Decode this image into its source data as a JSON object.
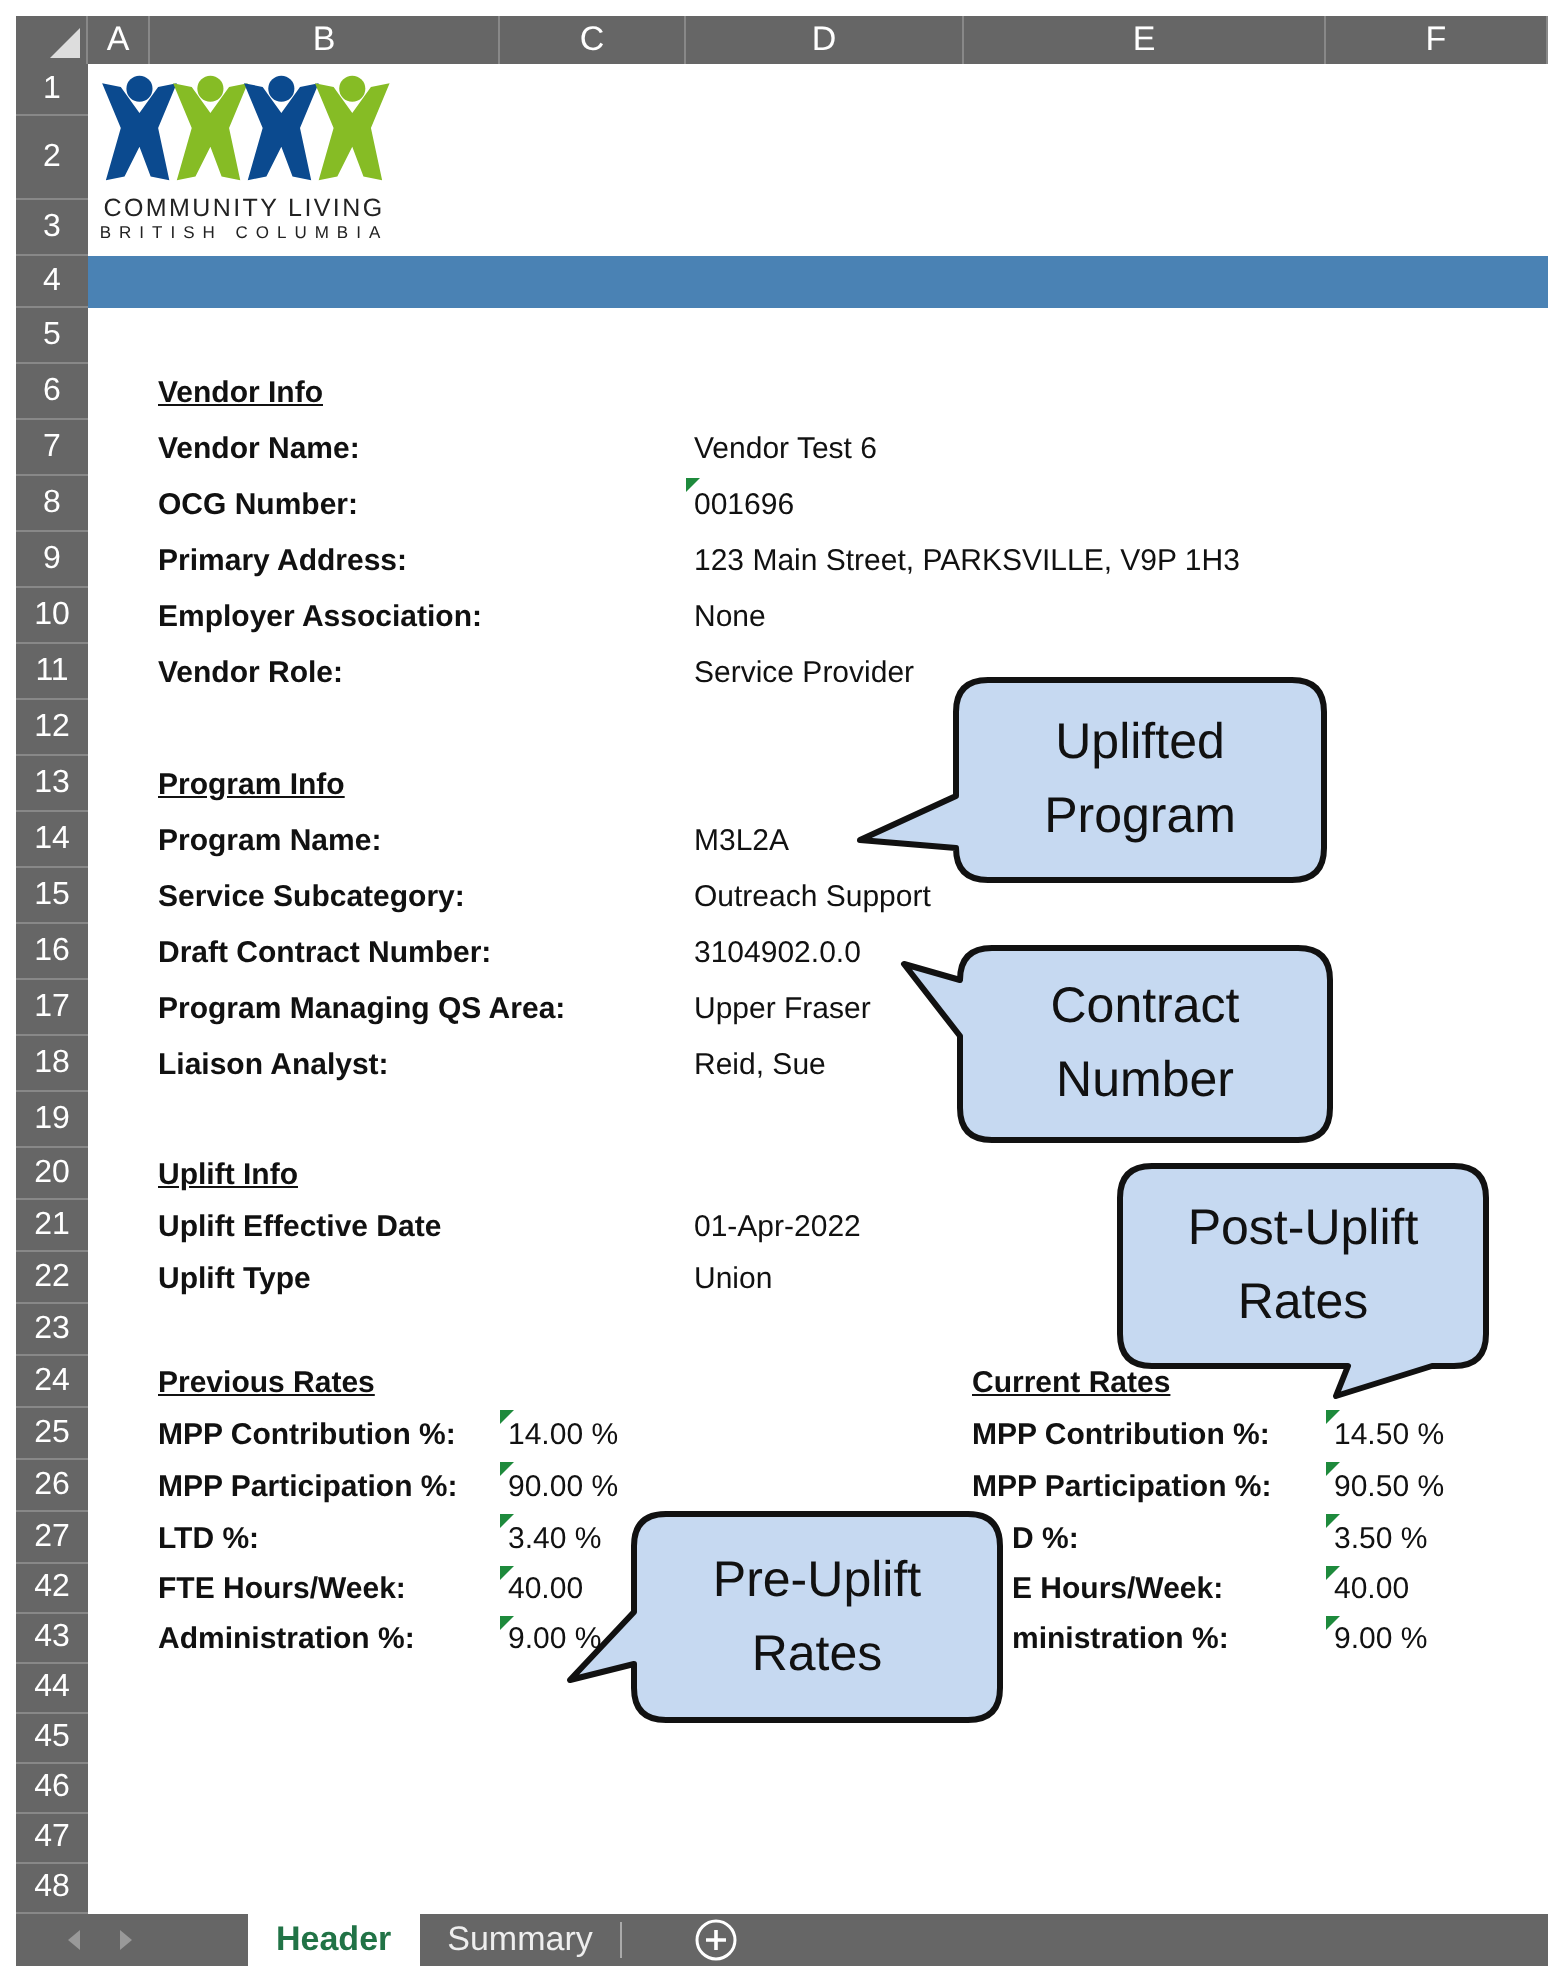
{
  "columns": [
    "A",
    "B",
    "C",
    "D",
    "E",
    "F"
  ],
  "logo": {
    "line1": "COMMUNITY LIVING",
    "line2": "BRITISH COLUMBIA"
  },
  "rows": [
    {
      "number": "1",
      "kind": "plain",
      "cells": {}
    },
    {
      "number": "2",
      "kind": "plain",
      "cells": {}
    },
    {
      "number": "3",
      "kind": "plain",
      "cells": {}
    },
    {
      "number": "4",
      "kind": "band",
      "cells": {}
    },
    {
      "number": "5",
      "kind": "plain",
      "cells": {}
    },
    {
      "number": "6",
      "kind": "plain",
      "cells": {
        "B": {
          "kind": "heading",
          "text": "Vendor Info",
          "flagged": false
        }
      }
    },
    {
      "number": "7",
      "kind": "plain",
      "cells": {
        "B": {
          "kind": "label",
          "text": "Vendor Name:",
          "flagged": false
        },
        "D": {
          "kind": "value",
          "text": "Vendor Test 6",
          "flagged": false
        }
      }
    },
    {
      "number": "8",
      "kind": "plain",
      "cells": {
        "B": {
          "kind": "label",
          "text": "OCG Number:",
          "flagged": false
        },
        "D": {
          "kind": "value",
          "text": "001696",
          "flagged": true
        }
      }
    },
    {
      "number": "9",
      "kind": "plain",
      "cells": {
        "B": {
          "kind": "label",
          "text": "Primary Address:",
          "flagged": false
        },
        "D": {
          "kind": "value",
          "text": " 123 Main Street, PARKSVILLE, V9P 1H3",
          "flagged": false
        }
      }
    },
    {
      "number": "10",
      "kind": "plain",
      "cells": {
        "B": {
          "kind": "label",
          "text": "Employer Association:",
          "flagged": false
        },
        "D": {
          "kind": "value",
          "text": "None",
          "flagged": false
        }
      }
    },
    {
      "number": "11",
      "kind": "plain",
      "cells": {
        "B": {
          "kind": "label",
          "text": "Vendor Role:",
          "flagged": false
        },
        "D": {
          "kind": "value",
          "text": "Service Provider",
          "flagged": false
        }
      }
    },
    {
      "number": "12",
      "kind": "plain",
      "cells": {}
    },
    {
      "number": "13",
      "kind": "plain",
      "cells": {
        "B": {
          "kind": "heading",
          "text": "Program Info",
          "flagged": false
        }
      }
    },
    {
      "number": "14",
      "kind": "plain",
      "cells": {
        "B": {
          "kind": "label",
          "text": "Program Name:",
          "flagged": false
        },
        "D": {
          "kind": "value",
          "text": "M3L2A",
          "flagged": false
        }
      }
    },
    {
      "number": "15",
      "kind": "plain",
      "cells": {
        "B": {
          "kind": "label",
          "text": "Service Subcategory:",
          "flagged": false
        },
        "D": {
          "kind": "value",
          "text": "Outreach Support",
          "flagged": false
        }
      }
    },
    {
      "number": "16",
      "kind": "plain",
      "cells": {
        "B": {
          "kind": "label",
          "text": "Draft Contract Number:",
          "flagged": false
        },
        "D": {
          "kind": "value",
          "text": "3104902.0.0",
          "flagged": false
        }
      }
    },
    {
      "number": "17",
      "kind": "plain",
      "cells": {
        "B": {
          "kind": "label",
          "text": "Program Managing QS Area:",
          "flagged": false
        },
        "D": {
          "kind": "value",
          "text": "Upper Fraser",
          "flagged": false
        }
      }
    },
    {
      "number": "18",
      "kind": "plain",
      "cells": {
        "B": {
          "kind": "label",
          "text": "Liaison Analyst:",
          "flagged": false
        },
        "D": {
          "kind": "value",
          "text": "Reid, Sue",
          "flagged": false
        }
      }
    },
    {
      "number": "19",
      "kind": "plain",
      "cells": {}
    },
    {
      "number": "20",
      "kind": "plain",
      "cells": {
        "B": {
          "kind": "heading",
          "text": "Uplift Info",
          "flagged": false
        }
      }
    },
    {
      "number": "21",
      "kind": "plain",
      "cells": {
        "B": {
          "kind": "label",
          "text": "Uplift Effective Date",
          "flagged": false
        },
        "D": {
          "kind": "value",
          "text": "01-Apr-2022",
          "flagged": false
        }
      }
    },
    {
      "number": "22",
      "kind": "plain",
      "cells": {
        "B": {
          "kind": "label",
          "text": "Uplift Type",
          "flagged": false
        },
        "D": {
          "kind": "value",
          "text": "Union",
          "flagged": false
        }
      }
    },
    {
      "number": "23",
      "kind": "plain",
      "cells": {}
    },
    {
      "number": "24",
      "kind": "plain",
      "cells": {
        "B": {
          "kind": "heading",
          "text": "Previous Rates",
          "flagged": false
        },
        "E": {
          "kind": "heading",
          "text": "Current Rates",
          "flagged": false
        }
      }
    },
    {
      "number": "25",
      "kind": "plain",
      "cells": {
        "B": {
          "kind": "label",
          "text": "MPP Contribution %:",
          "flagged": false
        },
        "C": {
          "kind": "value",
          "text": "14.00 %",
          "flagged": true
        },
        "E": {
          "kind": "label",
          "text": "MPP Contribution %:",
          "flagged": false
        },
        "F": {
          "kind": "value",
          "text": "14.50 %",
          "flagged": true
        }
      }
    },
    {
      "number": "26",
      "kind": "plain",
      "cells": {
        "B": {
          "kind": "label",
          "text": "MPP Participation %:",
          "flagged": false
        },
        "C": {
          "kind": "value",
          "text": "90.00 %",
          "flagged": true
        },
        "E": {
          "kind": "label",
          "text": "MPP Participation %:",
          "flagged": false
        },
        "F": {
          "kind": "value",
          "text": "90.50 %",
          "flagged": true
        }
      }
    },
    {
      "number": "27",
      "kind": "plain",
      "cells": {
        "B": {
          "kind": "label",
          "text": "LTD %:",
          "flagged": false
        },
        "C": {
          "kind": "value",
          "text": "3.40 %",
          "flagged": true
        },
        "E": {
          "kind": "cut-label",
          "text": "D %:",
          "flagged": false
        },
        "F": {
          "kind": "value",
          "text": "3.50 %",
          "flagged": true
        }
      }
    },
    {
      "number": "42",
      "kind": "plain",
      "cells": {
        "B": {
          "kind": "label",
          "text": "FTE Hours/Week:",
          "flagged": false
        },
        "C": {
          "kind": "value",
          "text": "40.00",
          "flagged": true
        },
        "E": {
          "kind": "cut-label",
          "text": "E Hours/Week:",
          "flagged": false
        },
        "F": {
          "kind": "value",
          "text": "40.00",
          "flagged": true
        }
      }
    },
    {
      "number": "43",
      "kind": "plain",
      "cells": {
        "B": {
          "kind": "label",
          "text": "Administration %:",
          "flagged": false
        },
        "C": {
          "kind": "value",
          "text": "9.00 %",
          "flagged": true
        },
        "E": {
          "kind": "cut-label",
          "text": "ministration %:",
          "flagged": false
        },
        "F": {
          "kind": "value",
          "text": "9.00 %",
          "flagged": true
        }
      }
    },
    {
      "number": "44",
      "kind": "plain",
      "cells": {}
    },
    {
      "number": "45",
      "kind": "plain",
      "cells": {}
    },
    {
      "number": "46",
      "kind": "plain",
      "cells": {}
    },
    {
      "number": "47",
      "kind": "plain",
      "cells": {}
    },
    {
      "number": "48",
      "kind": "plain",
      "cells": {}
    }
  ],
  "callouts": [
    {
      "text": "Uplifted Program"
    },
    {
      "text": "Contract Number"
    },
    {
      "text": "Post-Uplift Rates"
    },
    {
      "text": "Pre-Uplift Rates"
    }
  ],
  "sheet_tabs": [
    {
      "label": "Header",
      "selected": true
    },
    {
      "label": "Summary",
      "selected": false
    }
  ]
}
